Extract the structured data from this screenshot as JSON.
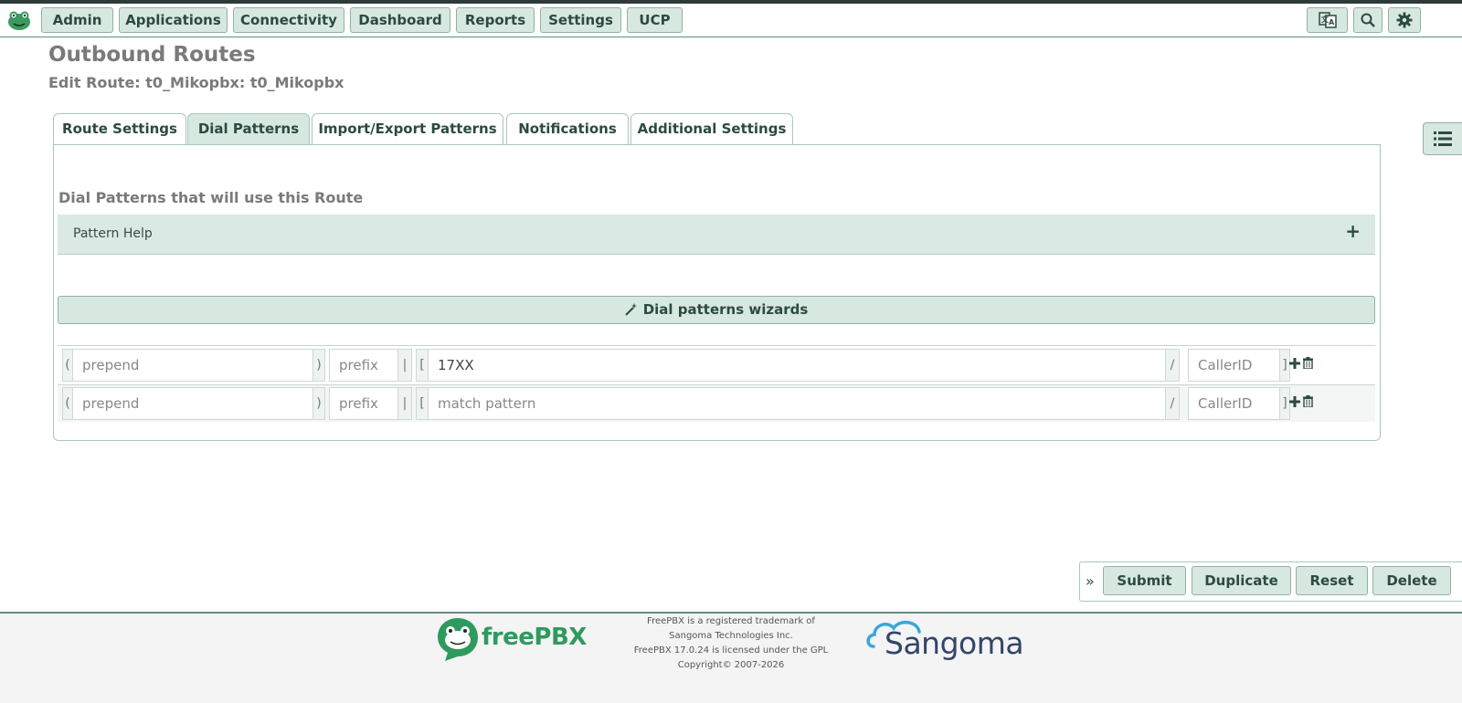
{
  "nav": {
    "items": [
      "Admin",
      "Applications",
      "Connectivity",
      "Dashboard",
      "Reports",
      "Settings",
      "UCP"
    ]
  },
  "page": {
    "title": "Outbound Routes",
    "subtitle": "Edit Route: t0_Mikopbx: t0_Mikopbx"
  },
  "tabs": [
    "Route Settings",
    "Dial Patterns",
    "Import/Export Patterns",
    "Notifications",
    "Additional Settings"
  ],
  "active_tab": "Dial Patterns",
  "section": {
    "title": "Dial Patterns that will use this Route",
    "help_label": "Pattern Help",
    "wizard_label": "Dial patterns wizards"
  },
  "symbols": {
    "open_paren": "(",
    "close_paren": ")",
    "pipe": "|",
    "open_bracket": "[",
    "slash": "/",
    "close_bracket": "]"
  },
  "patterns": [
    {
      "prepend_placeholder": "prepend",
      "prefix_placeholder": "prefix",
      "match_value": "17XX",
      "match_placeholder": "match pattern",
      "callerid_placeholder": "CallerID"
    },
    {
      "prepend_placeholder": "prepend",
      "prefix_placeholder": "prefix",
      "match_value": "",
      "match_placeholder": "match pattern",
      "callerid_placeholder": "CallerID"
    }
  ],
  "actions": {
    "chevron": "»",
    "submit": "Submit",
    "duplicate": "Duplicate",
    "reset": "Reset",
    "delete": "Delete"
  },
  "footer": {
    "line1": "FreePBX is a registered trademark of",
    "line2": "Sangoma Technologies Inc.",
    "line3": "FreePBX 17.0.24 is licensed under the GPL",
    "line4": "Copyright© 2007-2026",
    "freepbx_logo_text": "freePBX",
    "sangoma_logo_text": "Sangoma"
  },
  "colors": {
    "accent": "#d7e8e0",
    "accent_border": "#8fb3a4",
    "text_dark_green": "#2c4a42",
    "freepbx_green": "#2f9a5e",
    "sangoma_blue": "#33456a"
  }
}
